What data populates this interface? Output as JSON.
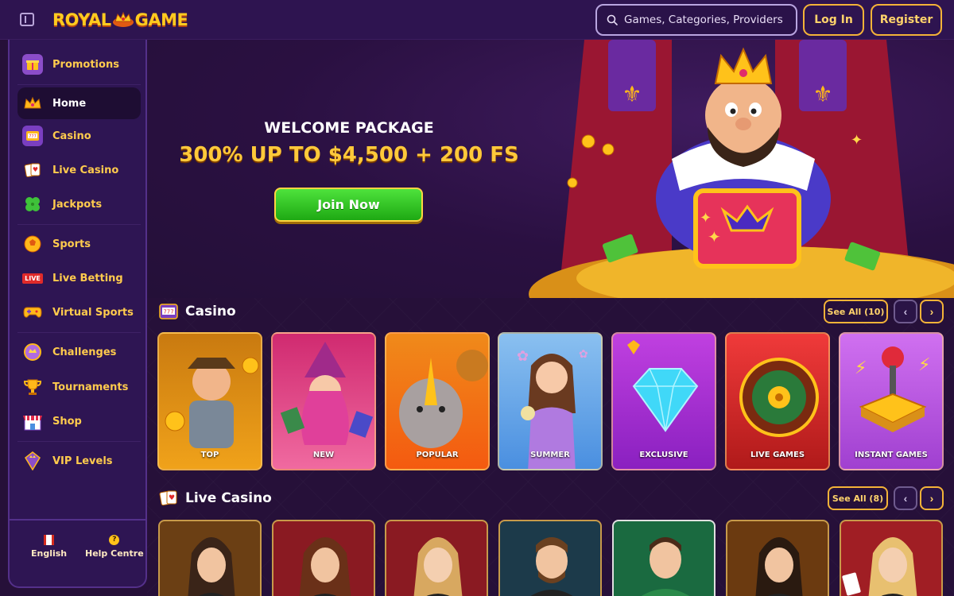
{
  "header": {
    "logo_left": "ROYAL",
    "logo_right": "GAME",
    "search_placeholder": "Games, Categories, Providers",
    "login_label": "Log In",
    "register_label": "Register"
  },
  "sidebar": {
    "items": [
      {
        "label": "Promotions",
        "icon": "gift-icon"
      },
      {
        "label": "Home",
        "icon": "crown-icon"
      },
      {
        "label": "Casino",
        "icon": "slot-machine-icon"
      },
      {
        "label": "Live Casino",
        "icon": "playing-cards-icon"
      },
      {
        "label": "Jackpots",
        "icon": "clover-icon"
      },
      {
        "label": "Sports",
        "icon": "ball-icon"
      },
      {
        "label": "Live Betting",
        "icon": "live-badge-icon",
        "badge": "LIVE"
      },
      {
        "label": "Virtual Sports",
        "icon": "gamepad-icon"
      },
      {
        "label": "Challenges",
        "icon": "medal-icon"
      },
      {
        "label": "Tournaments",
        "icon": "trophy-icon"
      },
      {
        "label": "Shop",
        "icon": "shop-icon"
      },
      {
        "label": "VIP Levels",
        "icon": "vip-gem-icon"
      }
    ],
    "active": "Home",
    "footer": {
      "language_label": "English",
      "help_label": "Help Centre",
      "help_glyph": "?"
    }
  },
  "hero": {
    "subtitle": "WELCOME PACKAGE",
    "title": "300% UP TO $4,500 + 200 FS",
    "cta_label": "Join Now"
  },
  "casino_section": {
    "title": "Casino",
    "see_all_label": "See All (10)",
    "prev_glyph": "‹",
    "next_glyph": "›",
    "cards": [
      {
        "label": "TOP",
        "color": "#f0a21a"
      },
      {
        "label": "NEW",
        "color": "#e8468e"
      },
      {
        "label": "POPULAR",
        "color": "#f47a1a"
      },
      {
        "label": "SUMMER",
        "color": "#4a8fe0"
      },
      {
        "label": "EXCLUSIVE",
        "color": "#b23ad6"
      },
      {
        "label": "LIVE GAMES",
        "color": "#e02a2a"
      },
      {
        "label": "INSTANT GAMES",
        "color": "#b94ae0"
      }
    ]
  },
  "live_section": {
    "title": "Live Casino",
    "see_all_label": "See All (8)",
    "prev_glyph": "‹",
    "next_glyph": "›",
    "cards": [
      {
        "color": "#6b3f14"
      },
      {
        "color": "#8a1a22"
      },
      {
        "color": "#8a1a22"
      },
      {
        "color": "#1c3a4a"
      },
      {
        "color": "#1a6a40"
      },
      {
        "color": "#6b3a10"
      },
      {
        "color": "#a01e24"
      }
    ]
  },
  "colors": {
    "accent": "#f4b338",
    "gold_text": "#ffcb4d",
    "background": "#261039",
    "sidebar": "#2e1553",
    "cta_green": "#2fbf1f"
  }
}
